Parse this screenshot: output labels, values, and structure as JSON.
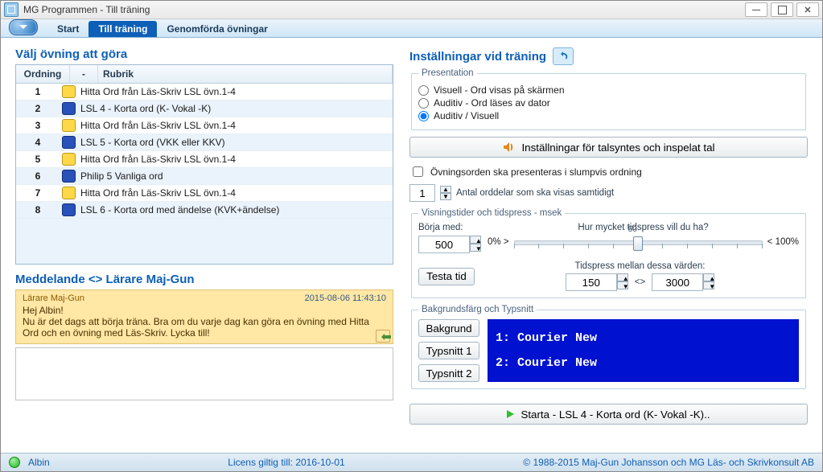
{
  "app": {
    "title": "MG Programmen - Till träning"
  },
  "tabs": {
    "start": "Start",
    "training": "Till träning",
    "done": "Genomförda övningar",
    "active": "training"
  },
  "exercise": {
    "heading": "Välj övning att göra",
    "headers": {
      "order": "Ordning",
      "icon": "-",
      "title": "Rubrik"
    },
    "rows": [
      {
        "n": "1",
        "kind": "yellow",
        "title": "Hitta Ord från Läs-Skriv LSL övn.1-4"
      },
      {
        "n": "2",
        "kind": "blue",
        "title": "LSL 4 - Korta ord (K- Vokal -K)"
      },
      {
        "n": "3",
        "kind": "yellow",
        "title": "Hitta Ord från Läs-Skriv LSL övn.1-4"
      },
      {
        "n": "4",
        "kind": "blue",
        "title": "LSL 5 - Korta ord (VKK eller KKV)"
      },
      {
        "n": "5",
        "kind": "yellow",
        "title": "Hitta Ord från Läs-Skriv LSL övn.1-4"
      },
      {
        "n": "6",
        "kind": "blue",
        "title": "Philip 5 Vanliga ord"
      },
      {
        "n": "7",
        "kind": "yellow",
        "title": "Hitta Ord från Läs-Skriv LSL övn.1-4"
      },
      {
        "n": "8",
        "kind": "blue",
        "title": "LSL 6 - Korta ord med ändelse  (KVK+ändelse)"
      }
    ]
  },
  "message": {
    "heading": "Meddelande <> Lärare Maj-Gun",
    "from": "Lärare Maj-Gun",
    "timestamp": "2015-08-06 11:43:10",
    "body": "Hej Albin!\nNu är det dags att börja träna. Bra om du varje dag kan göra en övning med Hitta Ord och en övning med Läs-Skriv. Lycka till!"
  },
  "settings": {
    "heading": "Inställningar vid träning",
    "presentation": {
      "legend": "Presentation",
      "visual": "Visuell - Ord visas på skärmen",
      "audio": "Auditiv - Ord läses av dator",
      "both": "Auditiv / Visuell",
      "selected": "both"
    },
    "tts_button": "Inställningar för talsyntes och inspelat tal",
    "random_order": "Övningsorden ska presenteras i slumpvis ordning",
    "parts": {
      "value": "1",
      "label": "Antal orddelar som ska visas samtidigt"
    },
    "timing": {
      "legend": "Visningstider och tidspress - msek",
      "start_with": "Börja med:",
      "start_value": "500",
      "pressure_q": "Hur mycket tidspress vill du ha?",
      "pct_left": "0% >",
      "pct_mid": "50",
      "pct_right": "< 100%",
      "between_label": "Tidspress mellan dessa värden:",
      "test_button": "Testa tid",
      "min": "150",
      "sep": "<>",
      "max": "3000"
    },
    "typo": {
      "legend": "Bakgrundsfärg och Typsnitt",
      "bg_btn": "Bakgrund",
      "font1_btn": "Typsnitt 1",
      "font2_btn": "Typsnitt 2",
      "preview1": "1: Courier New",
      "preview2": "2: Courier New"
    },
    "start_button": "Starta - LSL 4 - Korta ord (K- Vokal -K).."
  },
  "statusbar": {
    "user": "Albin",
    "license": "Licens giltig till: 2016-10-01",
    "copyright": "© 1988-2015 Maj-Gun Johansson och MG Läs- och Skrivkonsult AB"
  }
}
